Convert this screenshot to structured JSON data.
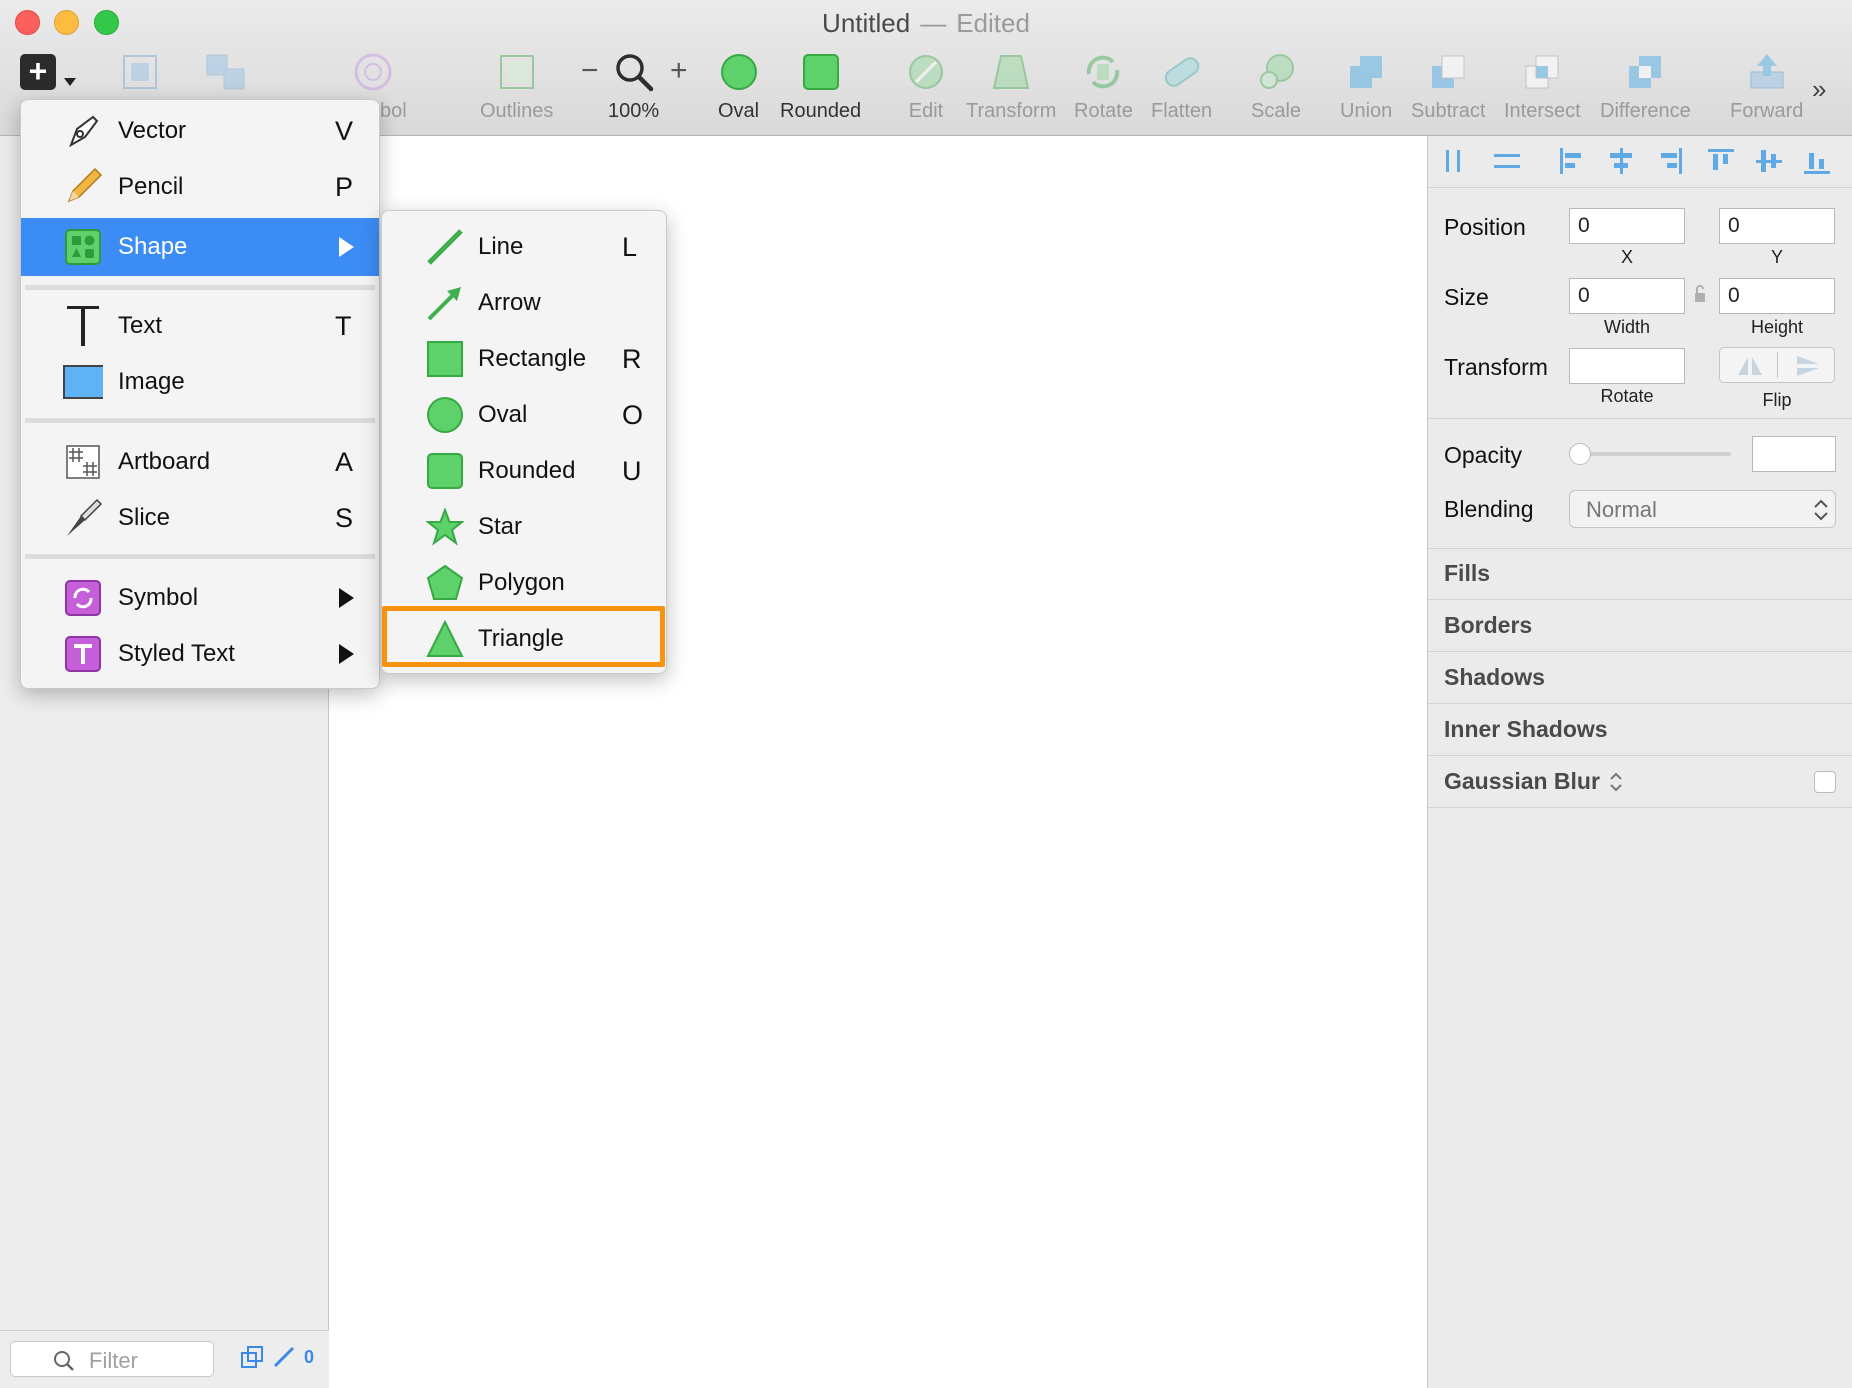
{
  "window": {
    "title": "Untitled",
    "separator": "—",
    "status": "Edited"
  },
  "toolbar": {
    "items": [
      {
        "label": "Symbol",
        "icon": "symbol-icon"
      },
      {
        "label": "Outlines",
        "icon": "outlines-icon"
      },
      {
        "label": "100%",
        "icon": "zoom-icon"
      },
      {
        "label": "Oval",
        "icon": "oval-icon"
      },
      {
        "label": "Rounded",
        "icon": "rounded-rect-icon"
      },
      {
        "label": "Edit",
        "icon": "edit-icon"
      },
      {
        "label": "Transform",
        "icon": "transform-icon"
      },
      {
        "label": "Rotate",
        "icon": "rotate-icon"
      },
      {
        "label": "Flatten",
        "icon": "flatten-icon"
      },
      {
        "label": "Scale",
        "icon": "scale-icon"
      },
      {
        "label": "Union",
        "icon": "union-icon"
      },
      {
        "label": "Subtract",
        "icon": "subtract-icon"
      },
      {
        "label": "Intersect",
        "icon": "intersect-icon"
      },
      {
        "label": "Difference",
        "icon": "difference-icon"
      },
      {
        "label": "Forward",
        "icon": "forward-icon"
      }
    ],
    "zoom_minus": "−",
    "zoom_plus": "+",
    "more": "»"
  },
  "insert_menu": {
    "items": [
      {
        "label": "Vector",
        "shortcut": "V",
        "icon": "vector-pen-icon"
      },
      {
        "label": "Pencil",
        "shortcut": "P",
        "icon": "pencil-icon"
      },
      {
        "label": "Shape",
        "shortcut": "",
        "icon": "shape-icon",
        "submenu": true,
        "active": true
      },
      {
        "label": "Text",
        "shortcut": "T",
        "icon": "text-icon"
      },
      {
        "label": "Image",
        "shortcut": "",
        "icon": "image-icon"
      },
      {
        "label": "Artboard",
        "shortcut": "A",
        "icon": "artboard-icon"
      },
      {
        "label": "Slice",
        "shortcut": "S",
        "icon": "slice-knife-icon"
      },
      {
        "label": "Symbol",
        "shortcut": "",
        "icon": "symbol-icon",
        "submenu": true
      },
      {
        "label": "Styled Text",
        "shortcut": "",
        "icon": "styled-text-icon",
        "submenu": true
      }
    ]
  },
  "shape_submenu": {
    "items": [
      {
        "label": "Line",
        "shortcut": "L",
        "icon": "line-icon"
      },
      {
        "label": "Arrow",
        "shortcut": "",
        "icon": "arrow-icon"
      },
      {
        "label": "Rectangle",
        "shortcut": "R",
        "icon": "rectangle-icon"
      },
      {
        "label": "Oval",
        "shortcut": "O",
        "icon": "oval-icon"
      },
      {
        "label": "Rounded",
        "shortcut": "U",
        "icon": "rounded-rect-icon"
      },
      {
        "label": "Star",
        "shortcut": "",
        "icon": "star-icon"
      },
      {
        "label": "Polygon",
        "shortcut": "",
        "icon": "polygon-icon"
      },
      {
        "label": "Triangle",
        "shortcut": "",
        "icon": "triangle-icon",
        "highlighted": true
      }
    ],
    "highlight_color": "#f7930e"
  },
  "inspector": {
    "position": {
      "label": "Position",
      "x": "0",
      "y": "0",
      "x_label": "X",
      "y_label": "Y"
    },
    "size": {
      "label": "Size",
      "width": "0",
      "height": "0",
      "width_label": "Width",
      "height_label": "Height"
    },
    "transform": {
      "label": "Transform",
      "rotate_value": "",
      "rotate_label": "Rotate",
      "flip_label": "Flip"
    },
    "opacity": {
      "label": "Opacity",
      "value": ""
    },
    "blending": {
      "label": "Blending",
      "value": "Normal"
    },
    "sections": [
      "Fills",
      "Borders",
      "Shadows",
      "Inner Shadows",
      "Gaussian Blur"
    ]
  },
  "layers": {
    "filter_placeholder": "Filter",
    "count": "0"
  },
  "colors": {
    "accent": "#3c8cf5",
    "shape_green": "#5fd16a",
    "highlight": "#f7930e"
  }
}
